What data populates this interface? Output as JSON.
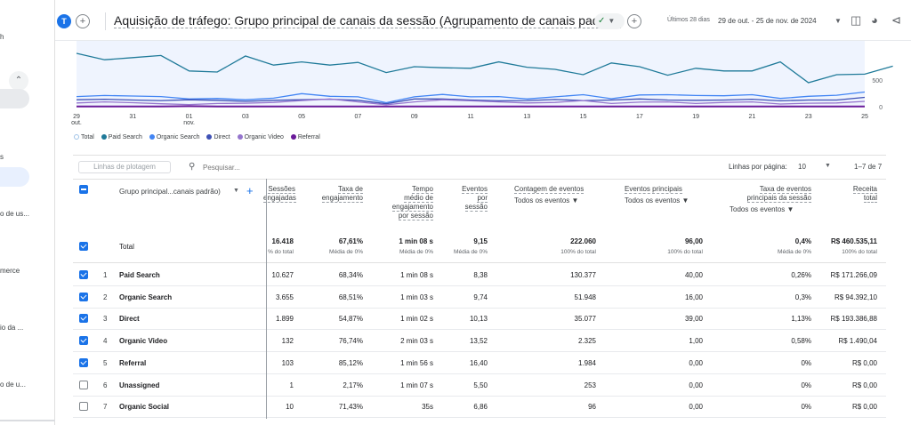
{
  "nav": {
    "items": [
      "h",
      "s",
      "o de us...",
      "merce",
      "io da ...",
      "o de u..."
    ]
  },
  "header": {
    "avatar_letter": "T",
    "title": "Aquisição de tráfego: Grupo principal de canais da sessão (Agrupamento de canais padrão)",
    "date_label": "Últimos 28 dias",
    "date_range": "29 de out. - 25 de nov. de 2024"
  },
  "chart": {
    "y_ticks": [
      "500",
      "0"
    ],
    "x_ticks": [
      "29 out.",
      "31",
      "01 nov.",
      "03",
      "05",
      "07",
      "09",
      "11",
      "13",
      "15",
      "17",
      "19",
      "21",
      "23",
      "25"
    ],
    "legend": [
      "Total",
      "Paid Search",
      "Organic Search",
      "Direct",
      "Organic Video",
      "Referral"
    ],
    "colors": {
      "total": "#9fc3e7",
      "paid_search": "#1f7a99",
      "organic_search": "#4285f4",
      "direct": "#3f51b5",
      "organic_video": "#9575cd",
      "referral": "#6a1b9a"
    },
    "series": {
      "total": [
        1500,
        1420,
        1490,
        1510,
        1430,
        1500,
        1480,
        1480,
        1380,
        1480,
        1470,
        1490,
        1490,
        1440,
        1470,
        1510,
        1490,
        1440,
        1490,
        1410,
        1480,
        1480,
        1480,
        1500,
        1480,
        1380,
        1490,
        1490,
        1380
      ],
      "paid_search": [
        1000,
        880,
        920,
        960,
        670,
        650,
        950,
        780,
        840,
        780,
        830,
        640,
        750,
        730,
        720,
        840,
        740,
        700,
        600,
        820,
        750,
        590,
        720,
        670,
        670,
        840,
        450,
        600,
        610,
        760
      ],
      "organic_search": [
        190,
        210,
        200,
        190,
        145,
        155,
        130,
        160,
        245,
        195,
        185,
        75,
        185,
        230,
        185,
        190,
        145,
        185,
        225,
        150,
        220,
        225,
        210,
        205,
        225,
        155,
        195,
        215,
        275
      ],
      "direct": [
        130,
        140,
        125,
        115,
        130,
        120,
        100,
        120,
        130,
        140,
        120,
        55,
        145,
        145,
        125,
        110,
        115,
        135,
        115,
        125,
        145,
        125,
        120,
        125,
        140,
        110,
        125,
        125,
        175
      ],
      "organic_video": [
        70,
        90,
        75,
        55,
        40,
        60,
        65,
        80,
        115,
        145,
        90,
        35,
        90,
        130,
        110,
        90,
        70,
        80,
        115,
        60,
        85,
        90,
        60,
        80,
        90,
        50,
        65,
        70,
        100
      ],
      "referral": [
        5,
        5,
        5,
        5,
        10,
        5,
        5,
        5,
        5,
        5,
        5,
        5,
        5,
        5,
        5,
        5,
        5,
        5,
        5,
        5,
        5,
        5,
        5,
        5,
        5,
        5,
        5,
        5,
        5
      ]
    }
  },
  "toolbar": {
    "plot_rows": "Linhas de plotagem",
    "search_placeholder": "Pesquisar...",
    "rows_per_page_label": "Linhas por página:",
    "rows_per_page": "10",
    "pager": "1–7 de 7"
  },
  "table": {
    "dimension_header": "Grupo principal...canais padrão)",
    "headers": {
      "sessions": [
        "Sessões",
        "engajadas"
      ],
      "eng_rate": [
        "Taxa de",
        "engajamento"
      ],
      "avg_time": [
        "Tempo",
        "médio de",
        "engajamento",
        "por sessão"
      ],
      "events_per": [
        "Eventos",
        "por",
        "sessão"
      ],
      "event_count": "Contagem de eventos",
      "event_count_sub": "Todos os eventos",
      "key_events": "Eventos principais",
      "key_events_sub": "Todos os eventos",
      "key_rate": [
        "Taxa de eventos",
        "principais da sessão"
      ],
      "key_rate_sub": "Todos os eventos",
      "revenue": [
        "Receita",
        "total"
      ]
    },
    "total": {
      "label": "Total",
      "sessions": "16.418",
      "sessions_sub": "% do total",
      "eng_rate": "67,61%",
      "eng_rate_sub": "Média de 0%",
      "avg_time": "1 min 08 s",
      "avg_time_sub": "Média de 0%",
      "events_per": "9,15",
      "events_per_sub": "Média de 0%",
      "event_count": "222.060",
      "event_count_sub": "100% do total",
      "key_events": "96,00",
      "key_events_sub": "100% do total",
      "key_rate": "0,4%",
      "key_rate_sub": "Média de 0%",
      "revenue": "R$ 460.535,11",
      "revenue_sub": "100% do total"
    },
    "rows": [
      {
        "n": "1",
        "name": "Paid Search",
        "checked": true,
        "sessions": "10.627",
        "eng_rate": "68,34%",
        "avg_time": "1 min 08 s",
        "events_per": "8,38",
        "event_count": "130.377",
        "key_events": "40,00",
        "key_rate": "0,26%",
        "revenue": "R$ 171.266,09"
      },
      {
        "n": "2",
        "name": "Organic Search",
        "checked": true,
        "sessions": "3.655",
        "eng_rate": "68,51%",
        "avg_time": "1 min 03 s",
        "events_per": "9,74",
        "event_count": "51.948",
        "key_events": "16,00",
        "key_rate": "0,3%",
        "revenue": "R$ 94.392,10"
      },
      {
        "n": "3",
        "name": "Direct",
        "checked": true,
        "sessions": "1.899",
        "eng_rate": "54,87%",
        "avg_time": "1 min 02 s",
        "events_per": "10,13",
        "event_count": "35.077",
        "key_events": "39,00",
        "key_rate": "1,13%",
        "revenue": "R$ 193.386,88"
      },
      {
        "n": "4",
        "name": "Organic Video",
        "checked": true,
        "sessions": "132",
        "eng_rate": "76,74%",
        "avg_time": "2 min 03 s",
        "events_per": "13,52",
        "event_count": "2.325",
        "key_events": "1,00",
        "key_rate": "0,58%",
        "revenue": "R$ 1.490,04"
      },
      {
        "n": "5",
        "name": "Referral",
        "checked": true,
        "sessions": "103",
        "eng_rate": "85,12%",
        "avg_time": "1 min 56 s",
        "events_per": "16,40",
        "event_count": "1.984",
        "key_events": "0,00",
        "key_rate": "0%",
        "revenue": "R$ 0,00"
      },
      {
        "n": "6",
        "name": "Unassigned",
        "checked": false,
        "sessions": "1",
        "eng_rate": "2,17%",
        "avg_time": "1 min 07 s",
        "events_per": "5,50",
        "event_count": "253",
        "key_events": "0,00",
        "key_rate": "0%",
        "revenue": "R$ 0,00"
      },
      {
        "n": "7",
        "name": "Organic Social",
        "checked": false,
        "sessions": "10",
        "eng_rate": "71,43%",
        "avg_time": "35s",
        "events_per": "6,86",
        "event_count": "96",
        "key_events": "0,00",
        "key_rate": "0%",
        "revenue": "R$ 0,00"
      }
    ]
  }
}
